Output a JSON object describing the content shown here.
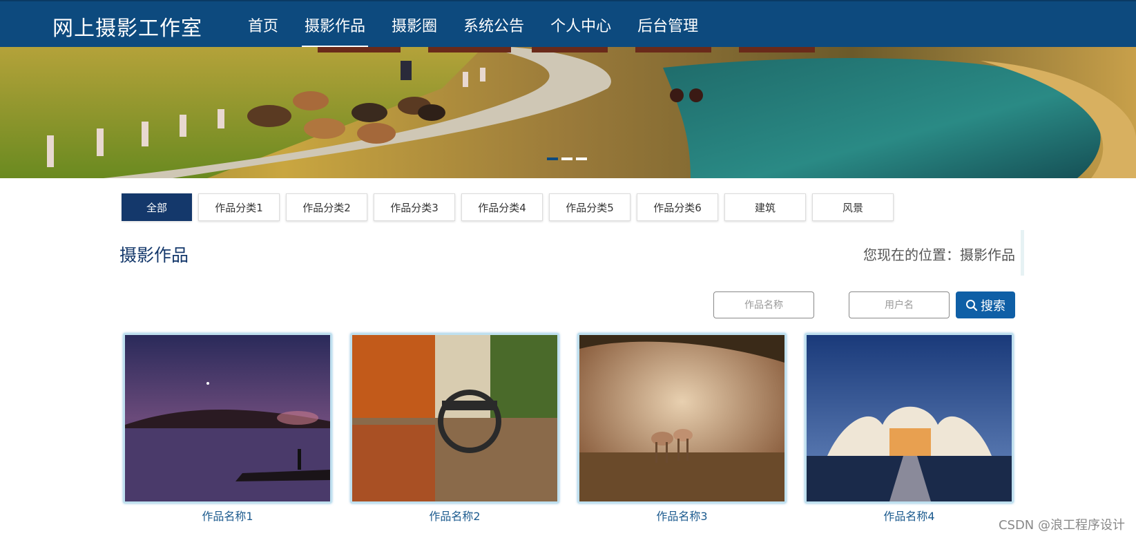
{
  "brand": "网上摄影工作室",
  "nav": [
    {
      "label": "首页",
      "active": false
    },
    {
      "label": "摄影作品",
      "active": true
    },
    {
      "label": "摄影圈",
      "active": false
    },
    {
      "label": "系统公告",
      "active": false
    },
    {
      "label": "个人中心",
      "active": false
    },
    {
      "label": "后台管理",
      "active": false
    }
  ],
  "banner": {
    "slides": 3,
    "active_slide": 1
  },
  "categories": [
    "全部",
    "作品分类1",
    "作品分类2",
    "作品分类3",
    "作品分类4",
    "作品分类5",
    "作品分类6",
    "建筑",
    "风景"
  ],
  "active_category": "全部",
  "section": {
    "title": "摄影作品",
    "location": "您现在的位置：摄影作品"
  },
  "search": {
    "work_placeholder": "作品名称",
    "user_placeholder": "用户名",
    "button_label": "搜索"
  },
  "works": [
    {
      "name": "作品名称1"
    },
    {
      "name": "作品名称2"
    },
    {
      "name": "作品名称3"
    },
    {
      "name": "作品名称4"
    }
  ],
  "watermark": "CSDN @浪工程序设计",
  "colors": {
    "header": "#0d4a7e",
    "active_category": "#14386b",
    "search_button": "#0f5fa6",
    "card_title": "#1b5a8e"
  }
}
